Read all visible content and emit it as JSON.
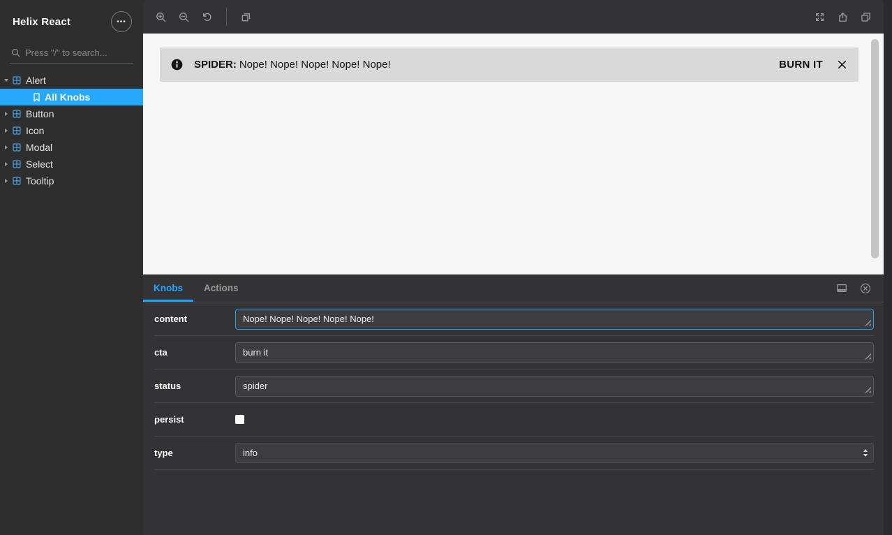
{
  "sidebar": {
    "title": "Helix React",
    "search": {
      "placeholder": "Press \"/\" to search..."
    },
    "tree": {
      "alert": {
        "label": "Alert",
        "expanded": true
      },
      "all_knobs": {
        "label": "All Knobs",
        "selected": true
      },
      "button": {
        "label": "Button"
      },
      "icon": {
        "label": "Icon"
      },
      "modal": {
        "label": "Modal"
      },
      "select": {
        "label": "Select"
      },
      "tooltip": {
        "label": "Tooltip"
      }
    }
  },
  "toolbar": {
    "icon_names": [
      "zoom-in",
      "zoom-out",
      "zoom-reset",
      "background",
      "fullscreen",
      "share",
      "open-in-new-tab"
    ]
  },
  "canvas": {
    "alert": {
      "status_prefix": "SPIDER:",
      "message": "Nope! Nope! Nope! Nope! Nope!",
      "cta_label": "BURN IT"
    }
  },
  "panel": {
    "tabs": {
      "knobs": "Knobs",
      "actions": "Actions"
    },
    "active_tab": "Knobs",
    "icon_names": [
      "panel-position",
      "close-panel"
    ],
    "knobs": [
      {
        "label": "content",
        "control": "textarea",
        "value": "Nope! Nope! Nope! Nope! Nope!",
        "focused": true
      },
      {
        "label": "cta",
        "control": "textarea",
        "value": "burn it",
        "focused": false
      },
      {
        "label": "status",
        "control": "textarea",
        "value": "spider",
        "focused": false
      },
      {
        "label": "persist",
        "control": "checkbox",
        "checked": false
      },
      {
        "label": "type",
        "control": "select",
        "value": "info"
      }
    ]
  },
  "icons": {
    "ellipsis-menu-icon": "•••",
    "search-icon": "⌕",
    "info-icon": "ℹ",
    "close-icon": "✕"
  },
  "colors": {
    "accent": "#1ea7fd",
    "selected_row_bg": "#26a9fc",
    "canvas_bg": "#f6f6f6",
    "alert_bg": "#d9d9d9",
    "panel_bg": "#333335",
    "sidebar_bg": "#2e2e2e"
  }
}
